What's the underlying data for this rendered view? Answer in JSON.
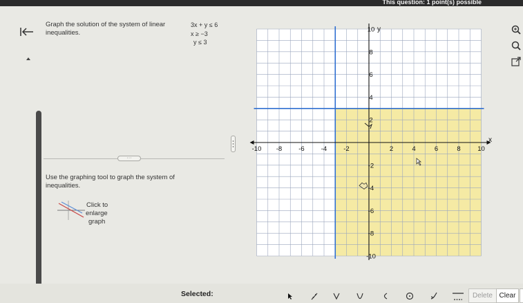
{
  "header": {
    "question_info": "This question: 1 point(s) possible"
  },
  "question": {
    "prompt": "Graph the solution of the system of linear inequalities.",
    "system": [
      "3x + y ≤ 6",
      "x ≥ −3",
      "y ≤ 3"
    ],
    "instruction": "Use the graphing tool to graph the system of inequalities.",
    "enlarge_lines": [
      "Click to",
      "enlarge",
      "graph"
    ],
    "divider_handle": "···"
  },
  "graph": {
    "x_axis_label": "x",
    "y_axis_label": "y",
    "x_range": [
      -10,
      10
    ],
    "y_range": [
      -10,
      10
    ],
    "x_ticks": [
      "-10",
      "-8",
      "-6",
      "-4",
      "-2",
      "2",
      "4",
      "6",
      "8",
      "10"
    ],
    "y_ticks": [
      "10",
      "8",
      "6",
      "4",
      "2",
      "-2",
      "-4",
      "-6",
      "-8",
      "-10"
    ],
    "shaded_region": {
      "x_min": -3,
      "x_max": 10,
      "y_min": -10,
      "y_max": 3
    },
    "boundary_lines": [
      {
        "equation": "x = -3"
      },
      {
        "equation": "y = 3"
      }
    ],
    "colors": {
      "shade": "#f5eaa4",
      "boundary": "#2f6fd1",
      "grid": "#9aa6bd",
      "axis": "#111111"
    }
  },
  "right_tools": [
    "zoom-in-icon",
    "zoom-out-icon",
    "popout-icon"
  ],
  "toolbar": {
    "selected_label": "Selected:",
    "tools": [
      "pointer-tool",
      "line-tool",
      "absolute-value-tool",
      "parabola-tool",
      "arc-tool",
      "circle-tool",
      "exponential-tool",
      "fill-tool"
    ],
    "delete_label": "Delete",
    "clear_label": "Clear"
  }
}
